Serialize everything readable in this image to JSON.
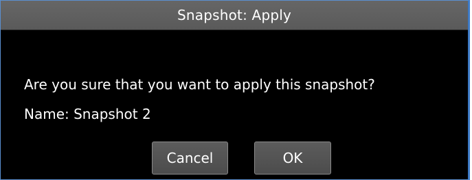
{
  "dialog": {
    "title": "Snapshot: Apply",
    "message": "Are you sure that you want to apply this snapshot?",
    "name_line": "Name: Snapshot 2",
    "buttons": {
      "cancel_label": "Cancel",
      "ok_label": "OK"
    }
  },
  "colors": {
    "dialog_background": "#000000",
    "titlebar_background": "#5f5f5f",
    "button_background": "#555555",
    "frame_border": "#3d79c4",
    "text": "#ffffff"
  }
}
